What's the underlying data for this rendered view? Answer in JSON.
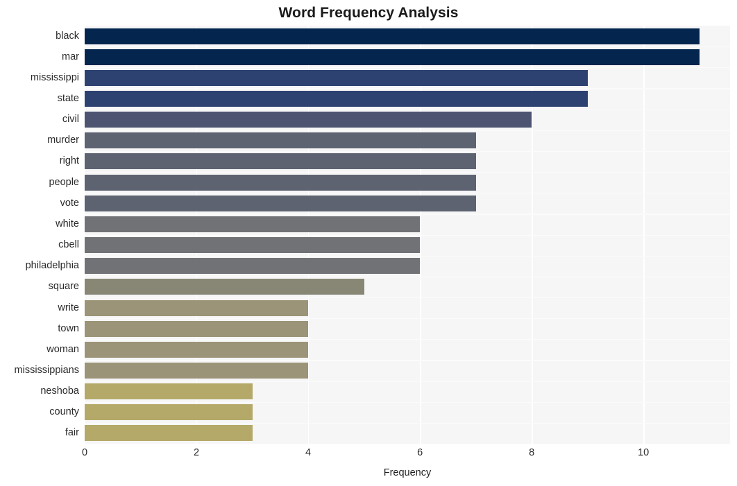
{
  "chart_data": {
    "type": "bar",
    "orientation": "horizontal",
    "title": "Word Frequency Analysis",
    "xlabel": "Frequency",
    "ylabel": "",
    "xlim": [
      0,
      11.55
    ],
    "ylim": null,
    "grid": true,
    "legend": null,
    "xticks": [
      "0",
      "2",
      "4",
      "6",
      "8",
      "10"
    ],
    "xtick_values": [
      0,
      2,
      4,
      6,
      8,
      10
    ],
    "categories": [
      "black",
      "mar",
      "mississippi",
      "state",
      "civil",
      "murder",
      "right",
      "people",
      "vote",
      "white",
      "cbell",
      "philadelphia",
      "square",
      "write",
      "town",
      "woman",
      "mississippians",
      "neshoba",
      "county",
      "fair"
    ],
    "values": [
      11,
      11,
      9,
      9,
      8,
      7,
      7,
      7,
      7,
      6,
      6,
      6,
      5,
      4,
      4,
      4,
      4,
      3,
      3,
      3
    ],
    "bar_colors": [
      "#04254e",
      "#04254e",
      "#2e4272",
      "#2e4272",
      "#4c5472",
      "#5e6372",
      "#5e6372",
      "#5e6372",
      "#5e6372",
      "#717275",
      "#717275",
      "#717275",
      "#888775",
      "#9c9478",
      "#9c9478",
      "#9c9478",
      "#9c9478",
      "#b4a968",
      "#b4a968",
      "#b4a968"
    ],
    "colors": {
      "figure_background": "#ffffff",
      "plot_background": "#f6f6f7",
      "grid": "#ffffff",
      "title": "#1a1a1a",
      "tick_label": "#2b2b2b"
    }
  }
}
